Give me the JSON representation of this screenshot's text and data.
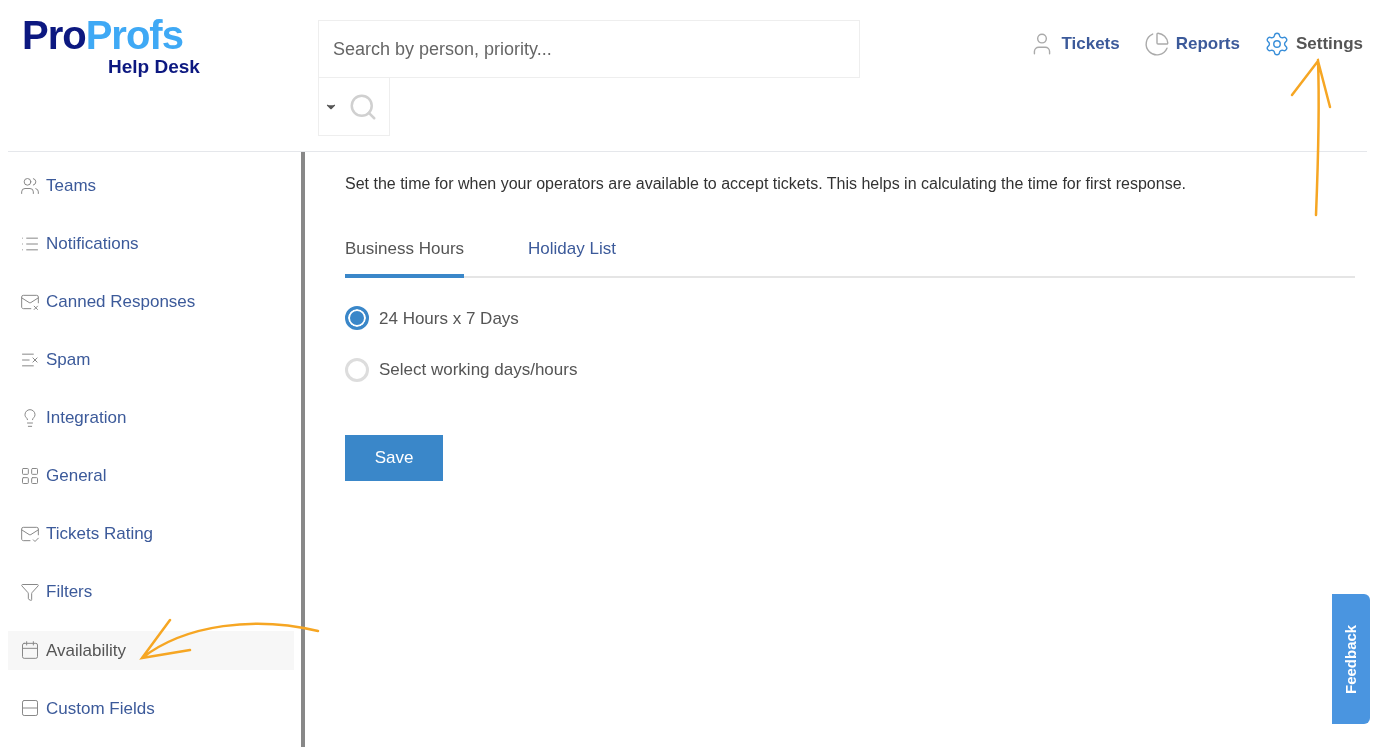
{
  "logo": {
    "part_1": "Pro",
    "part_2": "Profs",
    "subtitle": "Help Desk"
  },
  "search": {
    "placeholder": "Search by person, priority..."
  },
  "nav": [
    {
      "label": "Tickets",
      "kind": "person",
      "selected": false
    },
    {
      "label": "Reports",
      "kind": "chart",
      "selected": false
    },
    {
      "label": "Settings",
      "kind": "gear",
      "selected": true
    }
  ],
  "sidebar": {
    "items": [
      {
        "label": "Teams",
        "kind": "teams",
        "selected": false
      },
      {
        "label": "Notifications",
        "kind": "list",
        "selected": false
      },
      {
        "label": "Canned Responses",
        "kind": "mail",
        "selected": false
      },
      {
        "label": "Spam",
        "kind": "spam",
        "selected": false
      },
      {
        "label": "Integration",
        "kind": "bulb",
        "selected": false
      },
      {
        "label": "General",
        "kind": "grid",
        "selected": false
      },
      {
        "label": "Tickets Rating",
        "kind": "rating",
        "selected": false
      },
      {
        "label": "Filters",
        "kind": "filter",
        "selected": false
      },
      {
        "label": "Availability",
        "kind": "calendar",
        "selected": true
      },
      {
        "label": "Custom Fields",
        "kind": "fields",
        "selected": false
      }
    ]
  },
  "content": {
    "description": "Set the time for when your operators are available to accept tickets. This helps in calculating the time for first response.",
    "tabs": [
      {
        "label": "Business Hours",
        "selected": true
      },
      {
        "label": "Holiday List",
        "selected": false
      }
    ],
    "options": [
      {
        "label": "24 Hours x 7 Days",
        "selected": true
      },
      {
        "label": "Select working days/hours",
        "selected": false
      }
    ],
    "save_button": "Save"
  },
  "feedback_tab": "Feedback"
}
